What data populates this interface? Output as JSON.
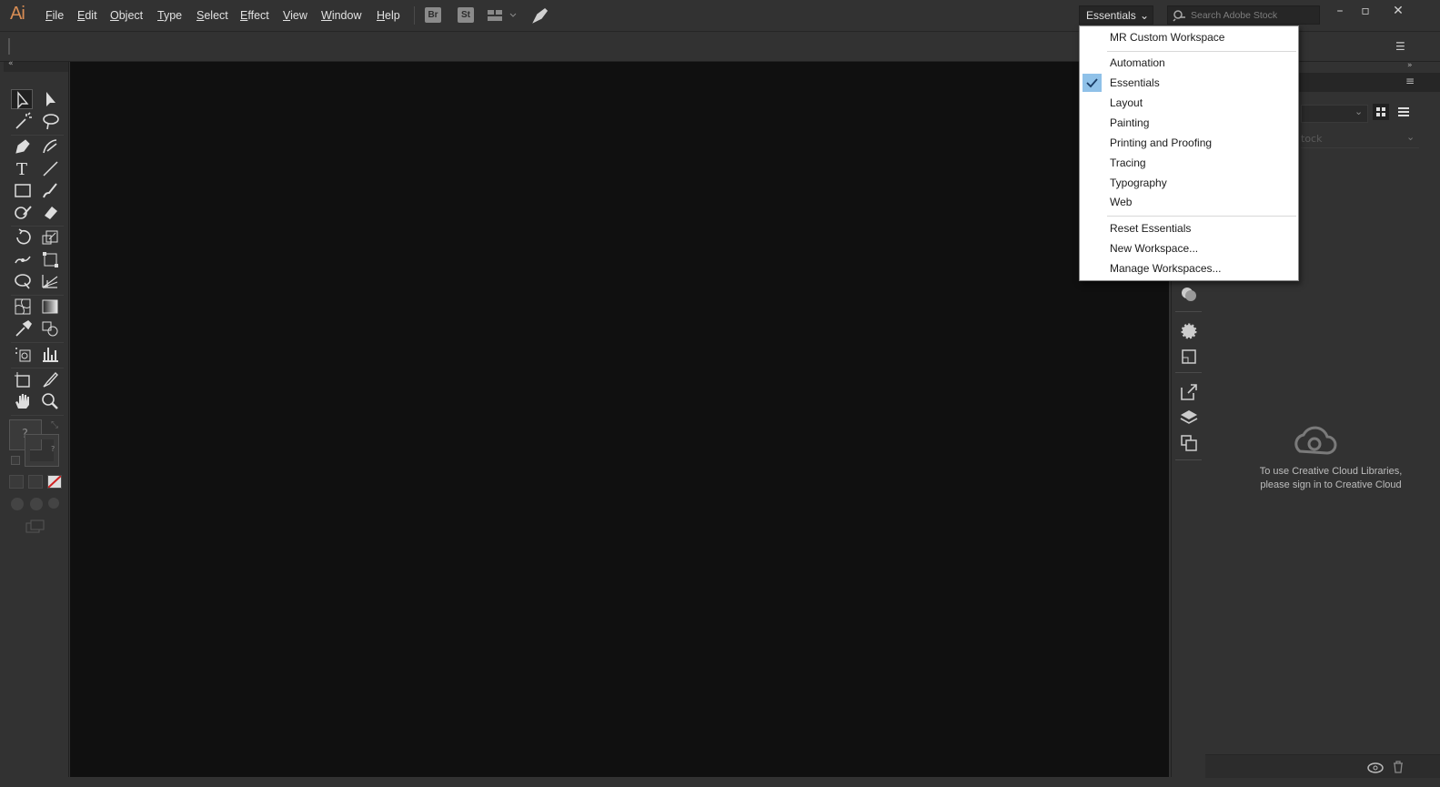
{
  "app": {
    "logo": "Ai"
  },
  "menu": [
    "File",
    "Edit",
    "Object",
    "Type",
    "Select",
    "Effect",
    "View",
    "Window",
    "Help"
  ],
  "toolbar": {
    "bridge_label": "Br",
    "stock_label": "St"
  },
  "workspace": {
    "current": "Essentials",
    "search_placeholder": "Search Adobe Stock",
    "menu": {
      "group1": [
        "MR Custom Workspace"
      ],
      "group2": [
        "Automation",
        "Essentials",
        "Layout",
        "Painting",
        "Printing and Proofing",
        "Tracing",
        "Typography",
        "Web"
      ],
      "group3": [
        "Reset Essentials",
        "New Workspace...",
        "Manage Workspaces..."
      ],
      "checked": "Essentials"
    }
  },
  "libraries": {
    "search_partial": "tock",
    "message_line1": "To use Creative Cloud Libraries,",
    "message_line2": "please sign in to Creative Cloud"
  },
  "tools_panel": {
    "unknown_fill": "?",
    "unknown_small": "?"
  },
  "colors": {
    "canvas": "#101010",
    "panel": "#323232",
    "logo": "#d88d54",
    "check_highlight": "#8fc1e8"
  }
}
